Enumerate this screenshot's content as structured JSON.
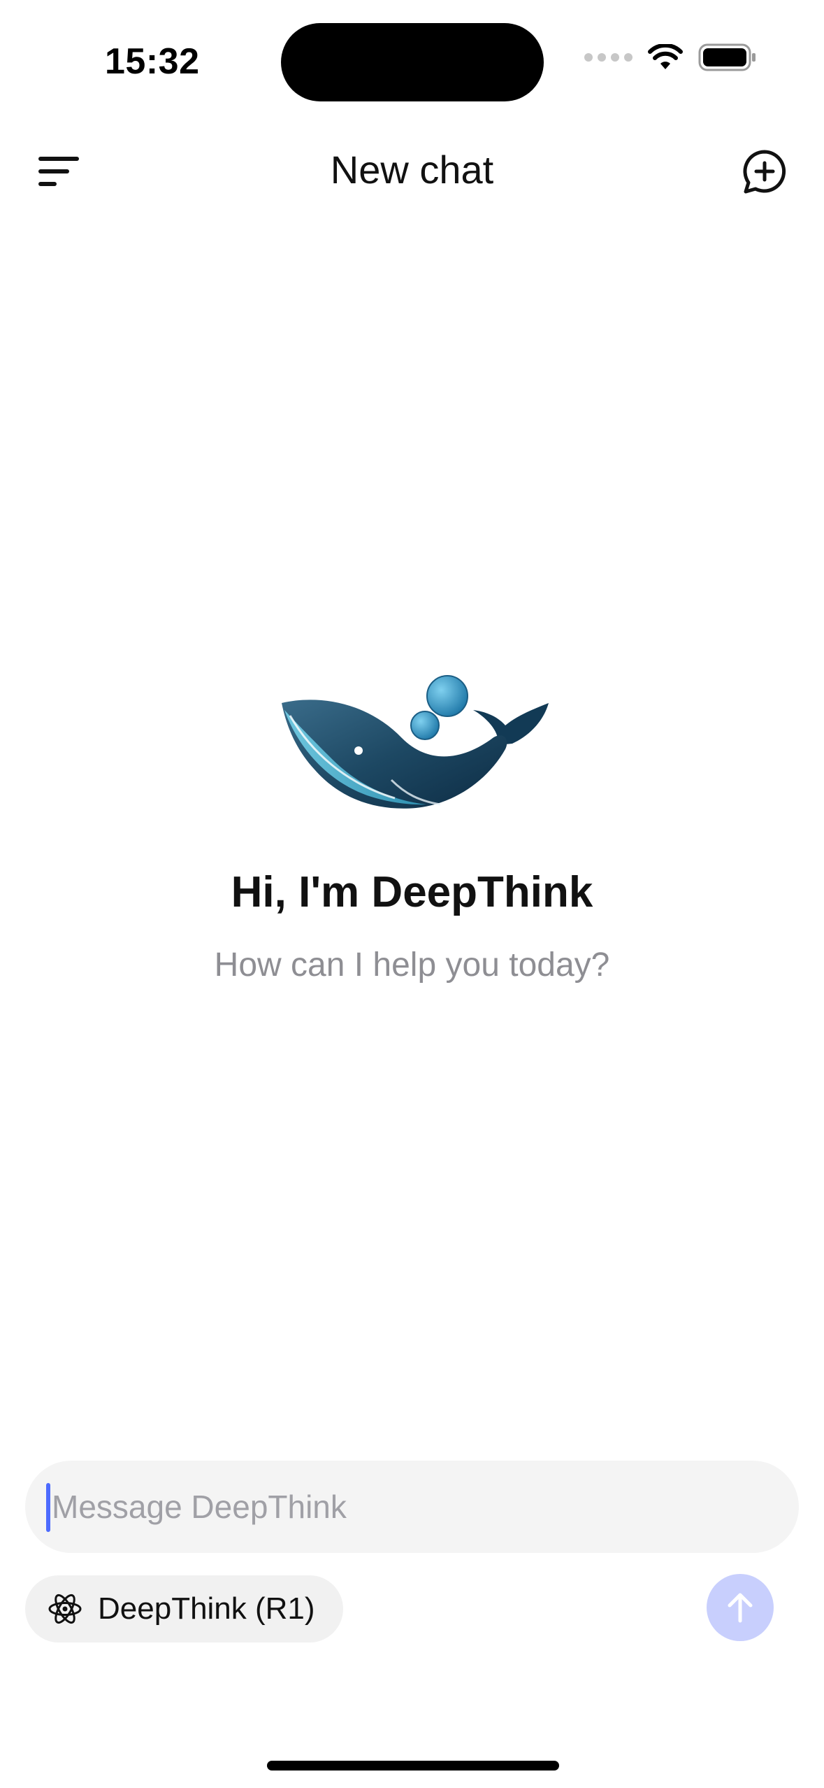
{
  "status_bar": {
    "time": "15:32"
  },
  "header": {
    "title": "New chat",
    "menu_icon": "menu-lines-icon",
    "new_chat_icon": "chat-bubble-plus-icon"
  },
  "hero": {
    "logo_icon": "whale-logo-icon",
    "title": "Hi, I'm DeepThink",
    "subtitle": "How can I help you today?"
  },
  "composer": {
    "placeholder": "Message DeepThink",
    "value": "",
    "accent_color": "#4d6bfe"
  },
  "toolbar": {
    "deepthink_label": "DeepThink (R1)",
    "deepthink_icon": "atom-icon",
    "send_icon": "arrow-up-icon",
    "send_button_color": "#c8cffd"
  }
}
